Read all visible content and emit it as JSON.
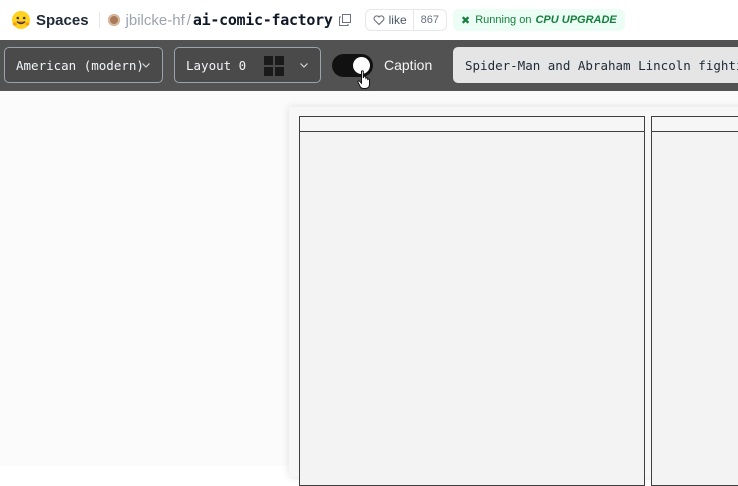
{
  "header": {
    "spaces_label": "Spaces",
    "owner": "jbilcke-hf",
    "separator": "/",
    "repo": "ai-comic-factory",
    "like_label": "like",
    "like_count": "867",
    "status_prefix": "Running on",
    "status_hardware": "CPU UPGRADE"
  },
  "toolbar": {
    "style_value": "American (modern)",
    "layout_value": "Layout 0",
    "caption_label": "Caption",
    "caption_enabled": true,
    "prompt_value": "Spider-Man and Abraham Lincoln fighting"
  },
  "colors": {
    "toolbar_bg": "#525252",
    "status_green": "#15803d",
    "toggle_on": "#111111"
  }
}
